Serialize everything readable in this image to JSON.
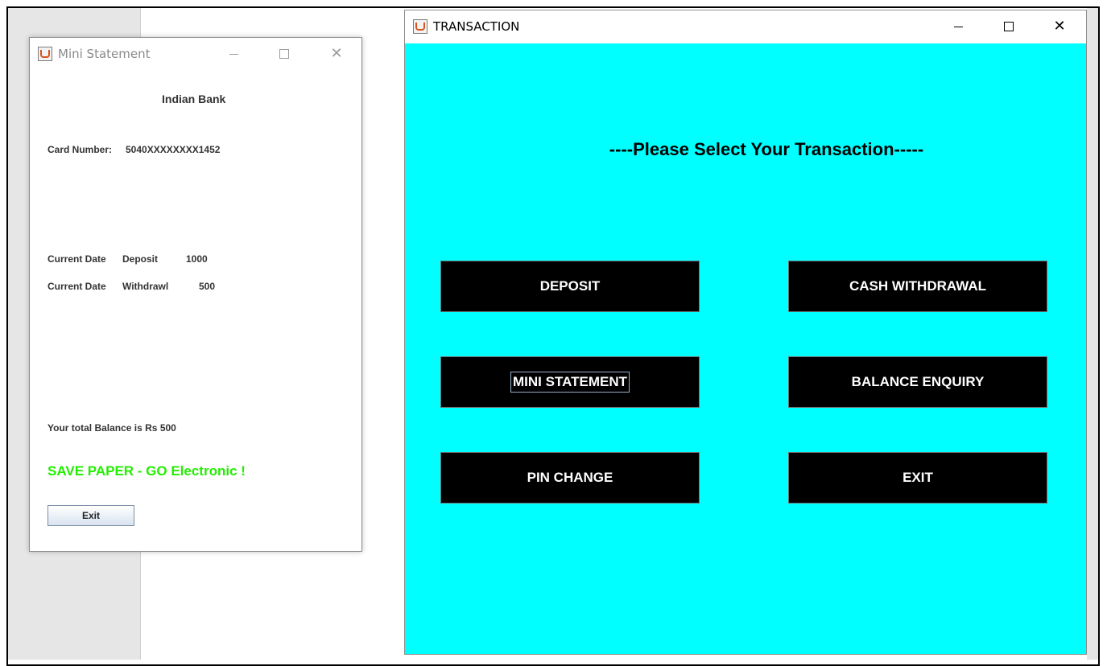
{
  "mini_statement": {
    "window_title": "Mini Statement",
    "bank_name": "Indian Bank",
    "card_label": "Card Number:",
    "card_number": "5040XXXXXXXX1452",
    "transactions": [
      {
        "date": "Current Date",
        "type": "Deposit",
        "amount": "1000"
      },
      {
        "date": "Current Date",
        "type": "Withdrawl",
        "amount": "500"
      }
    ],
    "balance_text": "Your total Balance is Rs 500",
    "slogan": "SAVE PAPER - GO Electronic !",
    "exit_label": "Exit",
    "slogan_color": "#22ee00"
  },
  "transaction": {
    "window_title": "TRANSACTION",
    "heading": "----Please Select Your Transaction-----",
    "background_color": "#00ffff",
    "buttons": {
      "deposit": "DEPOSIT",
      "cash_withdrawal": "CASH WITHDRAWAL",
      "mini_statement": "MINI STATEMENT",
      "balance_enquiry": "BALANCE ENQUIRY",
      "pin_change": "PIN CHANGE",
      "exit": "EXIT"
    }
  },
  "icons": {
    "app": "java-cup-icon",
    "minimize": "minimize-icon",
    "maximize": "maximize-icon",
    "close": "close-icon"
  }
}
